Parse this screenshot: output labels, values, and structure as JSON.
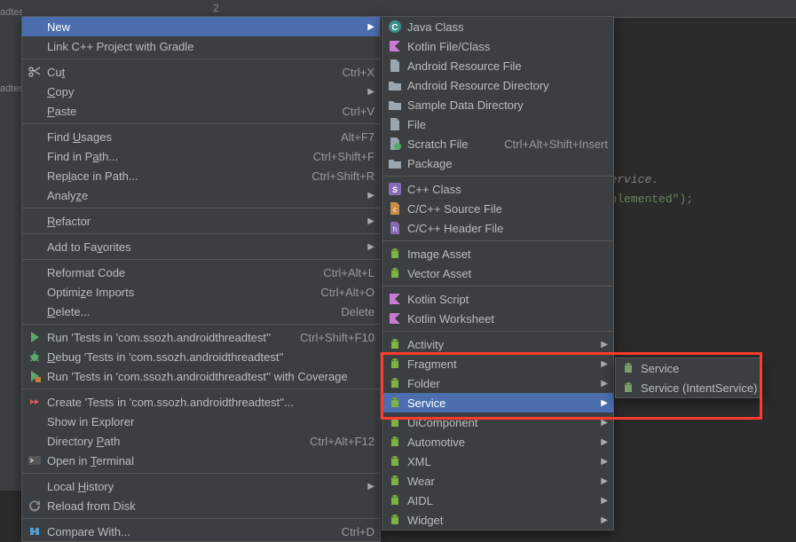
{
  "tab_area": {
    "num": "2"
  },
  "left_strip": {
    "t1": "adtes",
    "t2": "adtes"
  },
  "code": {
    "comment_tail": "to the service.",
    "string_tail": "Not yet implemented\");"
  },
  "menu1": [
    {
      "type": "item",
      "icon": "",
      "label": "New",
      "shortcut": "",
      "arrow": true,
      "hl": true,
      "name": "new"
    },
    {
      "type": "item",
      "icon": "",
      "label": "Link C++ Project with Gradle",
      "name": "link-cpp"
    },
    {
      "type": "sep"
    },
    {
      "type": "item",
      "icon": "scissors",
      "label": "Cut",
      "shortcut": "Ctrl+X",
      "ul": "t",
      "name": "cut"
    },
    {
      "type": "item",
      "icon": "",
      "label": "Copy",
      "shortcut": "",
      "arrow": true,
      "ul": "C",
      "name": "copy"
    },
    {
      "type": "item",
      "icon": "",
      "label": "Paste",
      "shortcut": "Ctrl+V",
      "ul": "P",
      "name": "paste"
    },
    {
      "type": "sep"
    },
    {
      "type": "item",
      "icon": "",
      "label": "Find Usages",
      "shortcut": "Alt+F7",
      "ul": "U",
      "name": "find-usages"
    },
    {
      "type": "item",
      "icon": "",
      "label": "Find in Path...",
      "shortcut": "Ctrl+Shift+F",
      "ul": "a",
      "name": "find-in-path"
    },
    {
      "type": "item",
      "icon": "",
      "label": "Replace in Path...",
      "shortcut": "Ctrl+Shift+R",
      "ul": "l",
      "name": "replace-in-path"
    },
    {
      "type": "item",
      "icon": "",
      "label": "Analyze",
      "arrow": true,
      "ul": "z",
      "name": "analyze"
    },
    {
      "type": "sep"
    },
    {
      "type": "item",
      "icon": "",
      "label": "Refactor",
      "arrow": true,
      "ul": "R",
      "name": "refactor"
    },
    {
      "type": "sep"
    },
    {
      "type": "item",
      "icon": "",
      "label": "Add to Favorites",
      "arrow": true,
      "ul": "v",
      "name": "favorites"
    },
    {
      "type": "sep"
    },
    {
      "type": "item",
      "icon": "",
      "label": "Reformat Code",
      "shortcut": "Ctrl+Alt+L",
      "name": "reformat"
    },
    {
      "type": "item",
      "icon": "",
      "label": "Optimize Imports",
      "shortcut": "Ctrl+Alt+O",
      "ul": "z",
      "name": "optimize-imports"
    },
    {
      "type": "item",
      "icon": "",
      "label": "Delete...",
      "shortcut": "Delete",
      "ul": "D",
      "name": "delete"
    },
    {
      "type": "sep"
    },
    {
      "type": "item",
      "icon": "play",
      "label": "Run 'Tests in 'com.ssozh.androidthreadtest''",
      "shortcut": "Ctrl+Shift+F10",
      "name": "run-tests"
    },
    {
      "type": "item",
      "icon": "bug",
      "label": "Debug 'Tests in 'com.ssozh.androidthreadtest''",
      "ul": "D",
      "name": "debug-tests"
    },
    {
      "type": "item",
      "icon": "coverage",
      "label": "Run 'Tests in 'com.ssozh.androidthreadtest'' with Coverage",
      "name": "run-coverage"
    },
    {
      "type": "sep"
    },
    {
      "type": "item",
      "icon": "red-arrows",
      "label": "Create 'Tests in 'com.ssozh.androidthreadtest''...",
      "name": "create-tests"
    },
    {
      "type": "item",
      "icon": "",
      "label": "Show in Explorer",
      "name": "show-explorer"
    },
    {
      "type": "item",
      "icon": "",
      "label": "Directory Path",
      "shortcut": "Ctrl+Alt+F12",
      "ul": "P",
      "name": "directory-path"
    },
    {
      "type": "item",
      "icon": "terminal",
      "label": "Open in Terminal",
      "ul": "T",
      "name": "open-terminal"
    },
    {
      "type": "sep"
    },
    {
      "type": "item",
      "icon": "",
      "label": "Local History",
      "arrow": true,
      "ul": "H",
      "name": "local-history"
    },
    {
      "type": "item",
      "icon": "reload",
      "label": "Reload from Disk",
      "name": "reload"
    },
    {
      "type": "sep"
    },
    {
      "type": "item",
      "icon": "compare",
      "label": "Compare With...",
      "shortcut": "Ctrl+D",
      "name": "compare-with"
    }
  ],
  "menu2": [
    {
      "type": "item",
      "icon": "class-c",
      "label": "Java Class",
      "name": "java-class"
    },
    {
      "type": "item",
      "icon": "kotlin",
      "label": "Kotlin File/Class",
      "name": "kotlin-file"
    },
    {
      "type": "item",
      "icon": "file",
      "label": "Android Resource File",
      "name": "android-res-file"
    },
    {
      "type": "item",
      "icon": "folder",
      "label": "Android Resource Directory",
      "name": "android-res-dir"
    },
    {
      "type": "item",
      "icon": "folder",
      "label": "Sample Data Directory",
      "name": "sample-data"
    },
    {
      "type": "item",
      "icon": "file",
      "label": "File",
      "name": "file"
    },
    {
      "type": "item",
      "icon": "scratch",
      "label": "Scratch File",
      "shortcut": "Ctrl+Alt+Shift+Insert",
      "name": "scratch-file"
    },
    {
      "type": "item",
      "icon": "folder",
      "label": "Package",
      "name": "package"
    },
    {
      "type": "sep"
    },
    {
      "type": "item",
      "icon": "cpp-s",
      "label": "C++ Class",
      "name": "cpp-class"
    },
    {
      "type": "item",
      "icon": "cpp-c",
      "label": "C/C++ Source File",
      "name": "cpp-source"
    },
    {
      "type": "item",
      "icon": "cpp-h",
      "label": "C/C++ Header File",
      "name": "cpp-header"
    },
    {
      "type": "sep"
    },
    {
      "type": "item",
      "icon": "android",
      "label": "Image Asset",
      "name": "image-asset"
    },
    {
      "type": "item",
      "icon": "android",
      "label": "Vector Asset",
      "name": "vector-asset"
    },
    {
      "type": "sep"
    },
    {
      "type": "item",
      "icon": "kotlin",
      "label": "Kotlin Script",
      "name": "kotlin-script"
    },
    {
      "type": "item",
      "icon": "kotlin",
      "label": "Kotlin Worksheet",
      "name": "kotlin-worksheet"
    },
    {
      "type": "sep"
    },
    {
      "type": "item",
      "icon": "android",
      "label": "Activity",
      "arrow": true,
      "name": "activity"
    },
    {
      "type": "item",
      "icon": "android",
      "label": "Fragment",
      "arrow": true,
      "name": "fragment"
    },
    {
      "type": "item",
      "icon": "android",
      "label": "Folder",
      "arrow": true,
      "name": "folder-sub"
    },
    {
      "type": "item",
      "icon": "android",
      "label": "Service",
      "arrow": true,
      "hl": true,
      "name": "service"
    },
    {
      "type": "item",
      "icon": "android",
      "label": "UiComponent",
      "arrow": true,
      "name": "uicomponent"
    },
    {
      "type": "item",
      "icon": "android",
      "label": "Automotive",
      "arrow": true,
      "name": "automotive"
    },
    {
      "type": "item",
      "icon": "android",
      "label": "XML",
      "arrow": true,
      "name": "xml"
    },
    {
      "type": "item",
      "icon": "android",
      "label": "Wear",
      "arrow": true,
      "name": "wear"
    },
    {
      "type": "item",
      "icon": "android",
      "label": "AIDL",
      "arrow": true,
      "name": "aidl"
    },
    {
      "type": "item",
      "icon": "android",
      "label": "Widget",
      "arrow": true,
      "name": "widget"
    }
  ],
  "menu3": [
    {
      "type": "item",
      "icon": "android-alt",
      "label": "Service",
      "name": "new-service"
    },
    {
      "type": "item",
      "icon": "android-alt",
      "label": "Service (IntentService)",
      "name": "new-intent-service"
    }
  ]
}
